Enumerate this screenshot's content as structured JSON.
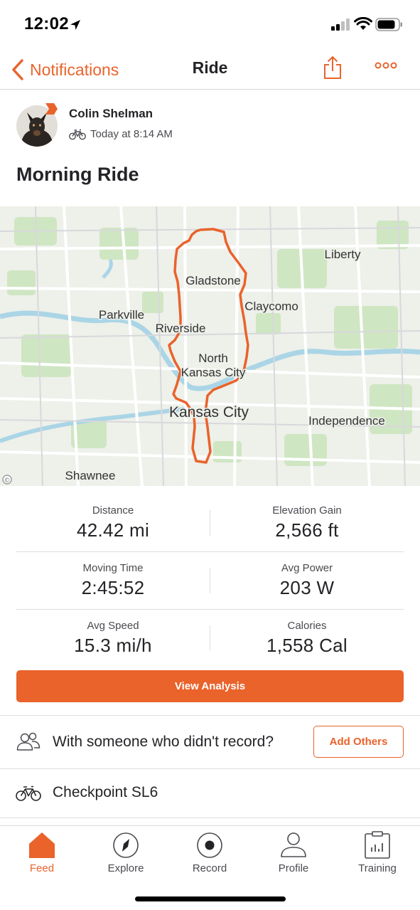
{
  "status_bar": {
    "time": "12:02"
  },
  "nav": {
    "back_label": "Notifications",
    "title": "Ride"
  },
  "activity": {
    "athlete_name": "Colin Shelman",
    "timestamp": "Today at 8:14 AM",
    "title": "Morning Ride"
  },
  "map": {
    "labels": [
      "Liberty",
      "Gladstone",
      "Claycomo",
      "Parkville",
      "Riverside",
      "North",
      "Kansas City",
      "Kansas City",
      "Independence",
      "Shawnee"
    ],
    "route_color": "#e9632b"
  },
  "stats": [
    {
      "label": "Distance",
      "value": "42.42 mi"
    },
    {
      "label": "Elevation Gain",
      "value": "2,566 ft"
    },
    {
      "label": "Moving Time",
      "value": "2:45:52"
    },
    {
      "label": "Avg Power",
      "value": "203 W"
    },
    {
      "label": "Avg Speed",
      "value": "15.3 mi/h"
    },
    {
      "label": "Calories",
      "value": "1,558 Cal"
    }
  ],
  "actions": {
    "view_analysis": "View Analysis",
    "with_someone": "With someone who didn't record?",
    "add_others": "Add Others",
    "gear": "Checkpoint SL6"
  },
  "tabs": [
    {
      "label": "Feed",
      "icon": "home-icon",
      "active": true
    },
    {
      "label": "Explore",
      "icon": "compass-icon",
      "active": false
    },
    {
      "label": "Record",
      "icon": "record-icon",
      "active": false
    },
    {
      "label": "Profile",
      "icon": "profile-icon",
      "active": false
    },
    {
      "label": "Training",
      "icon": "training-icon",
      "active": false
    }
  ],
  "colors": {
    "accent": "#e9632b",
    "text": "#242428",
    "muted": "#4a4a50"
  }
}
